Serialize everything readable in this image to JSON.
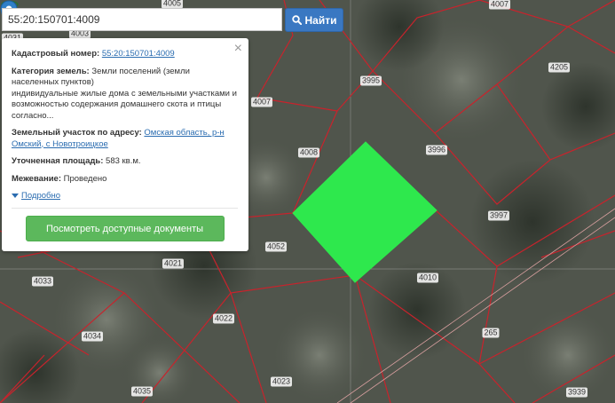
{
  "search": {
    "value": "55:20:150701:4009",
    "button_label": "Найти",
    "button_icon": "search-icon"
  },
  "popup": {
    "cadastral_label": "Кадастровый номер:",
    "cadastral_value": "55:20:150701:4009",
    "category_label": "Категория земель:",
    "category_value": "Земли поселений (земли населенных пунктов)",
    "category_detail": "индивидуальные жилые дома с земельными участками и возможностью содержания домашнего скота и птицы согласно...",
    "address_label": "Земельный участок по адресу:",
    "address_value": "Омская область, р-н Омский, с Новотроицкое",
    "area_label": "Уточненная площадь:",
    "area_value": "583 кв.м.",
    "survey_label": "Межевание:",
    "survey_value": "Проведено",
    "more_label": "Подробно",
    "docs_button": "Посмотреть доступные документы",
    "close_symbol": "×"
  },
  "parcel_labels": [
    "4005",
    "4003",
    "4031",
    "4007",
    "4205",
    "3995",
    "4007",
    "4008",
    "3996",
    "3997",
    "4052",
    "4021",
    "4010",
    "4033",
    "4022",
    "4034",
    "265",
    "4035",
    "4023",
    "3939"
  ],
  "colors": {
    "highlight": "#2ee84d",
    "boundary": "#c8232c",
    "button_primary": "#3a78c2",
    "button_success": "#5cb85c",
    "marker": "#2f7fc8"
  }
}
